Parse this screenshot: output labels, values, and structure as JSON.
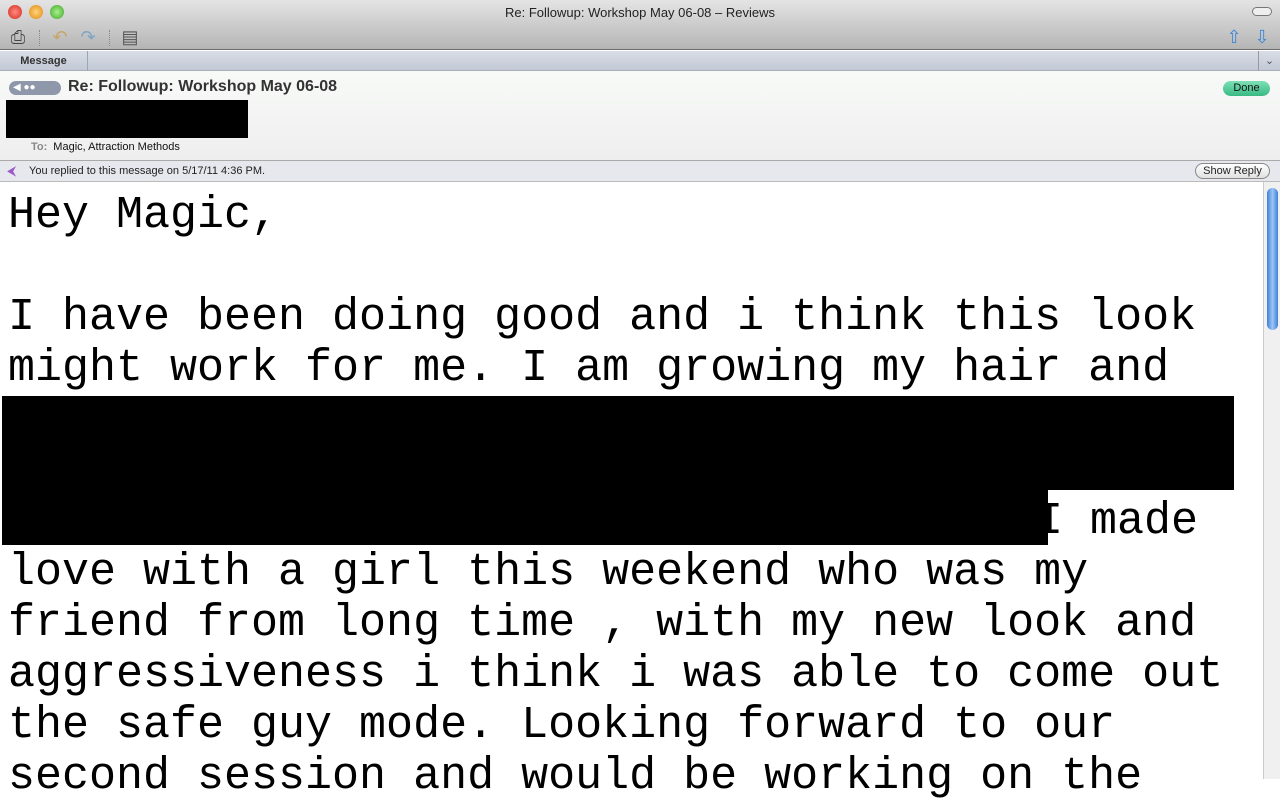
{
  "window": {
    "title": "Re: Followup: Workshop May 06-08 – Reviews"
  },
  "toolbar": {
    "icons": [
      "print-icon",
      "undo-icon",
      "redo-icon",
      "layout-icon",
      "previous-message-icon",
      "next-message-icon"
    ]
  },
  "tab": {
    "label": "Message"
  },
  "header": {
    "subject": "Re: Followup: Workshop May 06-08",
    "to_label": "To:",
    "to_value": "Magic, Attraction Methods",
    "done_label": "Done",
    "done_color": "#39b983"
  },
  "reply_bar": {
    "text": "You replied to this message on 5/17/11 4:36 PM.",
    "button": "Show Reply"
  },
  "body": {
    "lines": [
      "Hey Magic,",
      "",
      "I have been doing good and i think this look",
      "might work for me. I am growing my hair and",
      "",
      "",
      "                                      I made",
      "love with a girl this weekend who was my",
      "friend from long time , with my new look and",
      "aggressiveness i think i was able to come out",
      "the safe guy mode. Looking forward to our",
      "second session and would be working on the"
    ]
  }
}
